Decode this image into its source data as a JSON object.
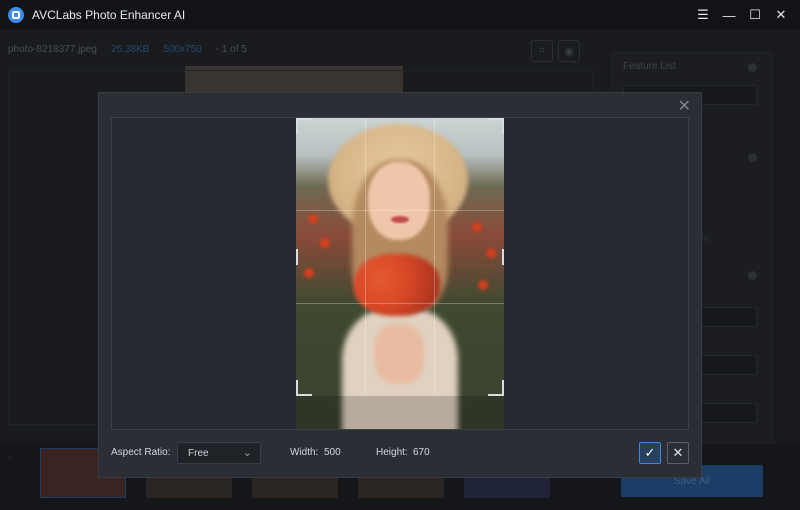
{
  "app": {
    "title": "AVCLabs Photo Enhancer AI",
    "accent_color": "#3b8ee8",
    "window_controls": [
      {
        "name": "menu-icon",
        "glyph": "☰"
      },
      {
        "name": "minimize-icon",
        "glyph": "—"
      },
      {
        "name": "maximize-icon",
        "glyph": "☐"
      },
      {
        "name": "close-icon",
        "glyph": "✕"
      }
    ]
  },
  "background": {
    "file_name": "photo-8218377.jpeg",
    "file_size": "25.38KB",
    "resolution": "500x750",
    "page_counter": "- 1 of 5",
    "feature_panel_title": "Feature List",
    "panel_text_fragment": "nt",
    "save_all_label": "Save All"
  },
  "crop_dialog": {
    "close_glyph": "✕",
    "aspect_ratio_label": "Aspect Ratio:",
    "aspect_ratio_value": "Free",
    "width_label": "Width:",
    "width_value": "500",
    "height_label": "Height:",
    "height_value": "670",
    "confirm_glyph": "✓",
    "cancel_glyph": "✕"
  }
}
